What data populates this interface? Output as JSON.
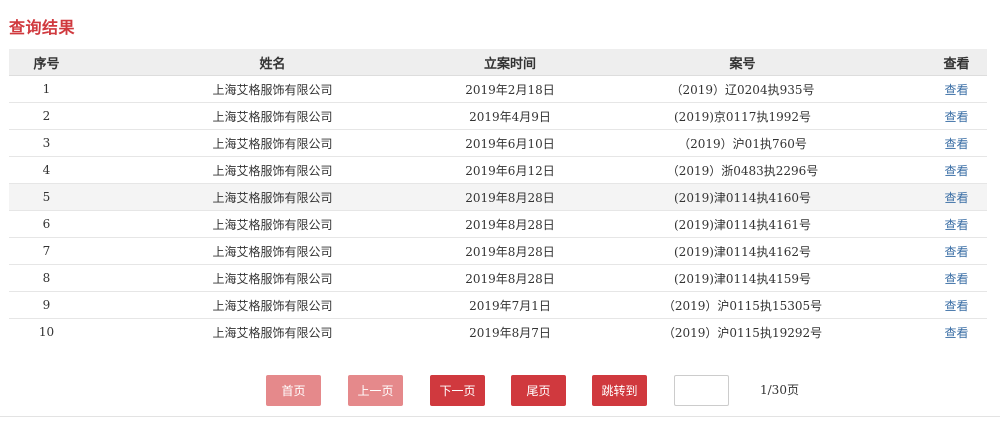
{
  "page_title": "查询结果",
  "table": {
    "headers": [
      "序号",
      "姓名",
      "立案时间",
      "案号",
      "查看"
    ],
    "rows": [
      {
        "idx": "1",
        "name": "上海艾格服饰有限公司",
        "date": "2019年2月18日",
        "case": "（2019）辽0204执935号",
        "view": "查看"
      },
      {
        "idx": "2",
        "name": "上海艾格服饰有限公司",
        "date": "2019年4月9日",
        "case": "(2019)京0117执1992号",
        "view": "查看"
      },
      {
        "idx": "3",
        "name": "上海艾格服饰有限公司",
        "date": "2019年6月10日",
        "case": "（2019）沪01执760号",
        "view": "查看"
      },
      {
        "idx": "4",
        "name": "上海艾格服饰有限公司",
        "date": "2019年6月12日",
        "case": "（2019）浙0483执2296号",
        "view": "查看"
      },
      {
        "idx": "5",
        "name": "上海艾格服饰有限公司",
        "date": "2019年8月28日",
        "case": "(2019)津0114执4160号",
        "view": "查看"
      },
      {
        "idx": "6",
        "name": "上海艾格服饰有限公司",
        "date": "2019年8月28日",
        "case": "(2019)津0114执4161号",
        "view": "查看"
      },
      {
        "idx": "7",
        "name": "上海艾格服饰有限公司",
        "date": "2019年8月28日",
        "case": "(2019)津0114执4162号",
        "view": "查看"
      },
      {
        "idx": "8",
        "name": "上海艾格服饰有限公司",
        "date": "2019年8月28日",
        "case": "(2019)津0114执4159号",
        "view": "查看"
      },
      {
        "idx": "9",
        "name": "上海艾格服饰有限公司",
        "date": "2019年7月1日",
        "case": "（2019）沪0115执15305号",
        "view": "查看"
      },
      {
        "idx": "10",
        "name": "上海艾格服饰有限公司",
        "date": "2019年8月7日",
        "case": "（2019）沪0115执19292号",
        "view": "查看"
      }
    ]
  },
  "pager": {
    "first": "首页",
    "prev": "上一页",
    "next": "下一页",
    "last": "尾页",
    "jump": "跳转到",
    "jump_value": "",
    "page_info": "1/30页"
  },
  "colors": {
    "accent": "#d0393e",
    "disabled": "#e5898b",
    "link": "#3a6ea5",
    "header_bg": "#eeeeee"
  }
}
